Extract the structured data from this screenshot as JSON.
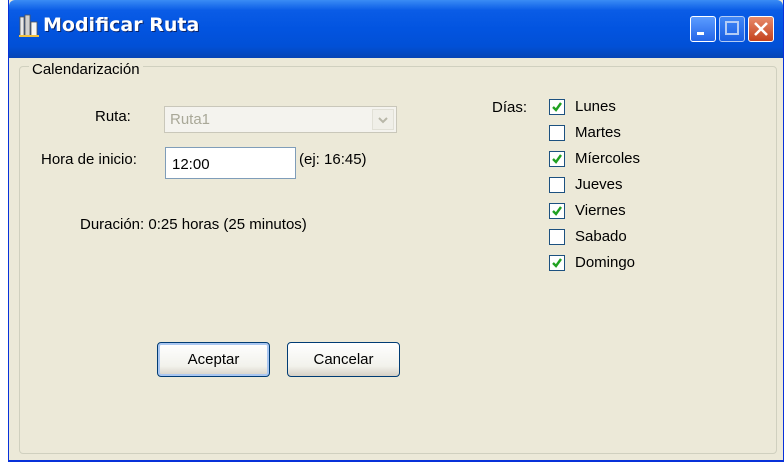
{
  "window": {
    "title": "Modificar Ruta"
  },
  "group": {
    "legend": "Calendarización"
  },
  "form": {
    "ruta_label": "Ruta:",
    "ruta_value": "Ruta1",
    "hora_label": "Hora de inicio:",
    "hora_value": "12:00",
    "hora_hint": "(ej: 16:45)",
    "duracion": "Duración: 0:25 horas (25 minutos)"
  },
  "dias": {
    "label": "Días:",
    "items": [
      {
        "label": "Lunes",
        "checked": true
      },
      {
        "label": "Martes",
        "checked": false
      },
      {
        "label": "Míercoles",
        "checked": true
      },
      {
        "label": "Jueves",
        "checked": false
      },
      {
        "label": "Viernes",
        "checked": true
      },
      {
        "label": "Sabado",
        "checked": false
      },
      {
        "label": "Domingo",
        "checked": true
      }
    ]
  },
  "buttons": {
    "accept": "Aceptar",
    "cancel": "Cancelar"
  },
  "colors": {
    "titlebar": "#0254e0",
    "window_bg": "#ece9d8",
    "check": "#21a121"
  }
}
